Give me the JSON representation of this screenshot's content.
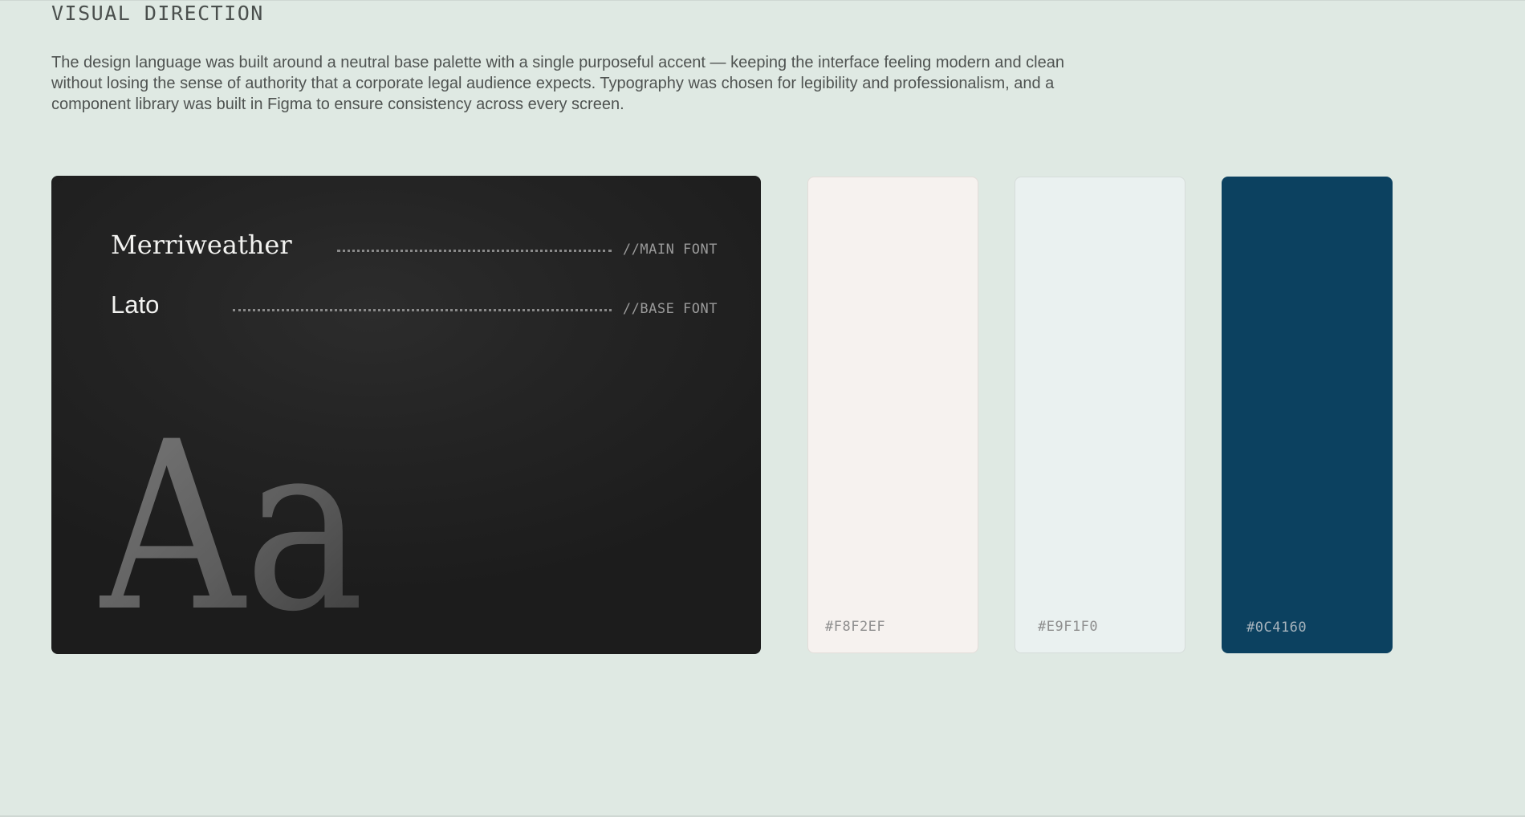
{
  "section": {
    "title": "VISUAL DIRECTION",
    "intro": "The design language was built around a neutral base palette with a single purposeful accent — keeping the interface feeling modern and clean without losing the sense of authority that a corporate legal audience expects. Typography was chosen for legibility and professionalism, and a component library was built in Figma to ensure consistency across every screen."
  },
  "typography": {
    "fonts": [
      {
        "name": "Merriweather",
        "role": "//MAIN FONT"
      },
      {
        "name": "Lato",
        "role": "//BASE FONT"
      }
    ],
    "specimen": "Aa"
  },
  "palette": [
    {
      "hex": "#F8F2EF",
      "color": "#f6f2ef"
    },
    {
      "hex": "#E9F1F0",
      "color": "#eaf1f0"
    },
    {
      "hex": "#0C4160",
      "color": "#0c4160"
    }
  ]
}
